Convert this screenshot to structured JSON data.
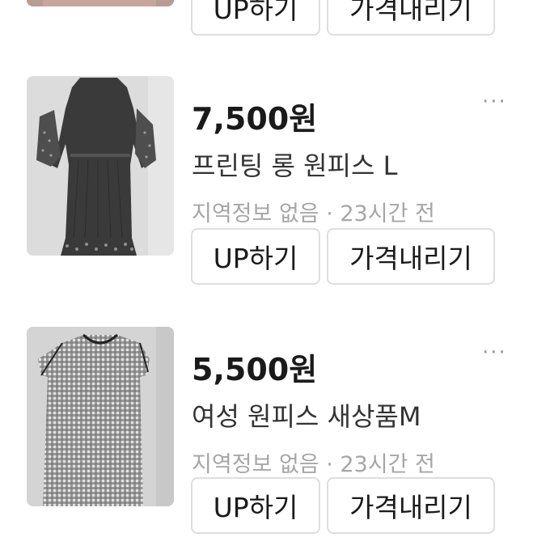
{
  "listings": [
    {
      "up_label": "UP하기",
      "price_down_label": "가격내리기"
    },
    {
      "price": "7,500원",
      "title": "프린팅 롱 원피스 L",
      "meta": "지역정보 없음 · 23시간 전",
      "more_label": "···",
      "up_label": "UP하기",
      "price_down_label": "가격내리기"
    },
    {
      "price": "5,500원",
      "title": "여성 원피스 새상품M",
      "meta": "지역정보 없음 · 23시간 전",
      "more_label": "···",
      "up_label": "UP하기",
      "price_down_label": "가격내리기"
    }
  ]
}
